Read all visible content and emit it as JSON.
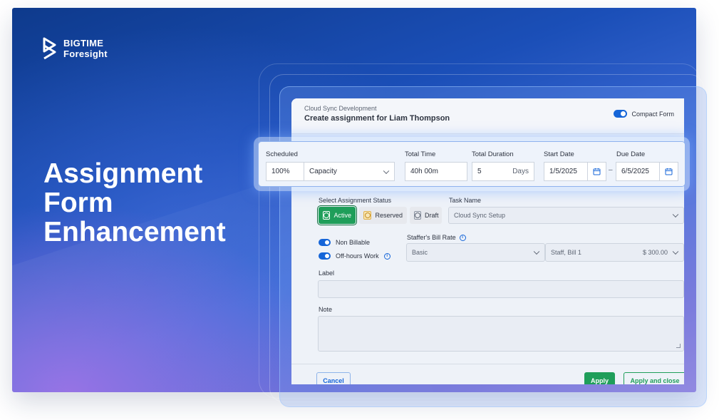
{
  "brand": {
    "line1": "BIGTIME",
    "line2": "Foresight"
  },
  "headline": [
    "Assignment",
    "Form",
    "Enhancement"
  ],
  "form": {
    "project": "Cloud Sync Development",
    "title": "Create assignment for Liam Thompson",
    "compact_form_label": "Compact Form",
    "scheduled_label": "Scheduled",
    "scheduled_value": "100%",
    "scheduled_unit": "Capacity",
    "total_time_label": "Total Time",
    "total_time_value": "40h 00m",
    "total_duration_label": "Total Duration",
    "total_duration_value": "5",
    "total_duration_unit": "Days",
    "start_date_label": "Start Date",
    "start_date_value": "1/5/2025",
    "date_separator": "–",
    "due_date_label": "Due Date",
    "due_date_value": "6/5/2025",
    "status_label": "Select Assignment Status",
    "statuses": [
      "Active",
      "Reserved",
      "Draft"
    ],
    "task_name_label": "Task Name",
    "task_name_value": "Cloud Sync Setup",
    "non_billable_label": "Non Billable",
    "off_hours_label": "Off-hours Work",
    "bill_rate_label": "Staffer's Bill Rate",
    "bill_rate_type": "Basic",
    "bill_rate_staff": "Staff, Bill 1",
    "bill_rate_amount": "$ 300.00",
    "label_label": "Label",
    "note_label": "Note",
    "cancel_label": "Cancel",
    "apply_label": "Apply",
    "apply_close_label": "Apply and close"
  }
}
